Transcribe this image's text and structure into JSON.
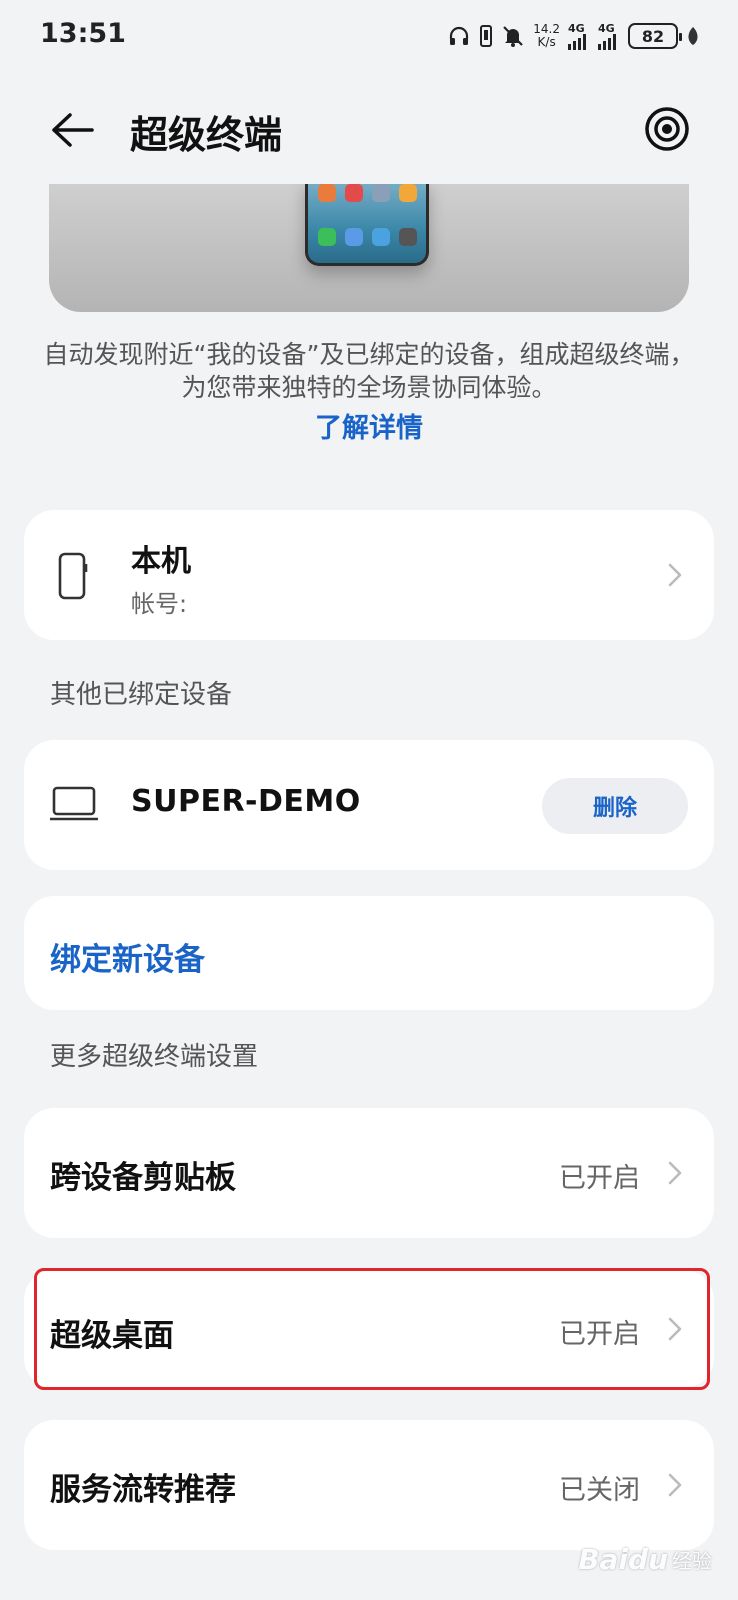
{
  "status_bar": {
    "time": "13:51",
    "speed_value": "14.2",
    "speed_unit": "K/s",
    "network_1": "4G",
    "network_2": "4G",
    "battery": "82"
  },
  "header": {
    "title": "超级终端"
  },
  "intro": {
    "description": "自动发现附近“我的设备”及已绑定的设备，组成超级终端，为您带来独特的全场景协同体验。",
    "learn_more": "了解详情"
  },
  "this_device": {
    "name": "本机",
    "account_label": "帐号:"
  },
  "other_devices": {
    "section_title": "其他已绑定设备",
    "items": [
      {
        "name": "SUPER-DEMO",
        "delete_label": "删除"
      }
    ]
  },
  "bind_new": {
    "label": "绑定新设备"
  },
  "more_settings": {
    "section_title": "更多超级终端设置",
    "items": [
      {
        "label": "跨设备剪贴板",
        "value": "已开启"
      },
      {
        "label": "超级桌面",
        "value": "已开启"
      },
      {
        "label": "服务流转推荐",
        "value": "已关闭"
      }
    ]
  },
  "watermark": {
    "text": "Baidu",
    "sub": "经验"
  },
  "colors": {
    "accent": "#1a63c7",
    "background": "#f1f3f5",
    "highlight": "#e0252c"
  }
}
